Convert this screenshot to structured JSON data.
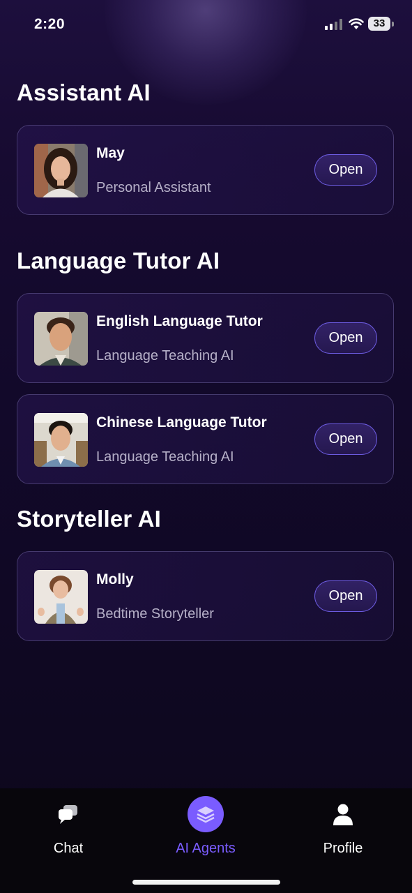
{
  "status": {
    "time": "2:20",
    "battery": "33"
  },
  "sections": [
    {
      "title": "Assistant AI"
    },
    {
      "title": "Language Tutor AI"
    },
    {
      "title": "Storyteller AI"
    }
  ],
  "agents": [
    {
      "name": "May",
      "role": "Personal Assistant",
      "action": "Open"
    },
    {
      "name": "English Language Tutor",
      "role": "Language Teaching AI",
      "action": "Open"
    },
    {
      "name": "Chinese Language Tutor",
      "role": "Language Teaching AI",
      "action": "Open"
    },
    {
      "name": "Molly",
      "role": "Bedtime Storyteller",
      "action": "Open"
    }
  ],
  "tabs": [
    {
      "label": "Chat",
      "icon": "chat-bubbles-icon"
    },
    {
      "label": "AI Agents",
      "icon": "layers-icon",
      "active": true
    },
    {
      "label": "Profile",
      "icon": "person-icon"
    }
  ],
  "colors": {
    "accent": "#7a5cff",
    "background": "#12092a"
  }
}
